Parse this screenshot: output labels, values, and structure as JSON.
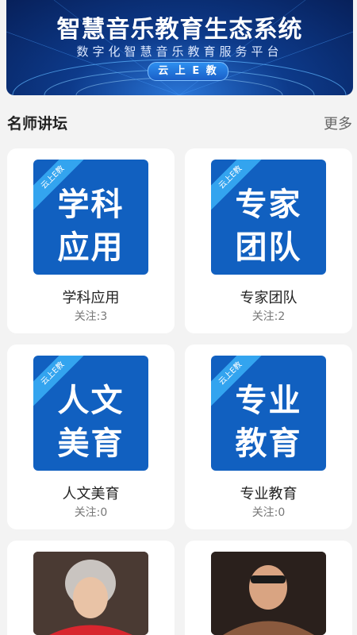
{
  "banner": {
    "title": "智慧音乐教育生态系统",
    "subtitle": "数字化智慧音乐教育服务平台",
    "badge": "云 上 E 教"
  },
  "section": {
    "title": "名师讲坛",
    "more": "更多"
  },
  "cards": [
    {
      "thumb_line1": "学科",
      "thumb_line2": "应用",
      "corner": "云上E教",
      "name": "学科应用",
      "follow": "关注:3"
    },
    {
      "thumb_line1": "专家",
      "thumb_line2": "团队",
      "corner": "云上E教",
      "name": "专家团队",
      "follow": "关注:2"
    },
    {
      "thumb_line1": "人文",
      "thumb_line2": "美育",
      "corner": "云上E教",
      "name": "人文美育",
      "follow": "关注:0"
    },
    {
      "thumb_line1": "专业",
      "thumb_line2": "教育",
      "corner": "云上E教",
      "name": "专业教育",
      "follow": "关注:0"
    }
  ],
  "colors": {
    "card_thumb_blue": "#1160c0",
    "corner_blue": "#33a4ef",
    "banner_dark": "#07205a"
  }
}
